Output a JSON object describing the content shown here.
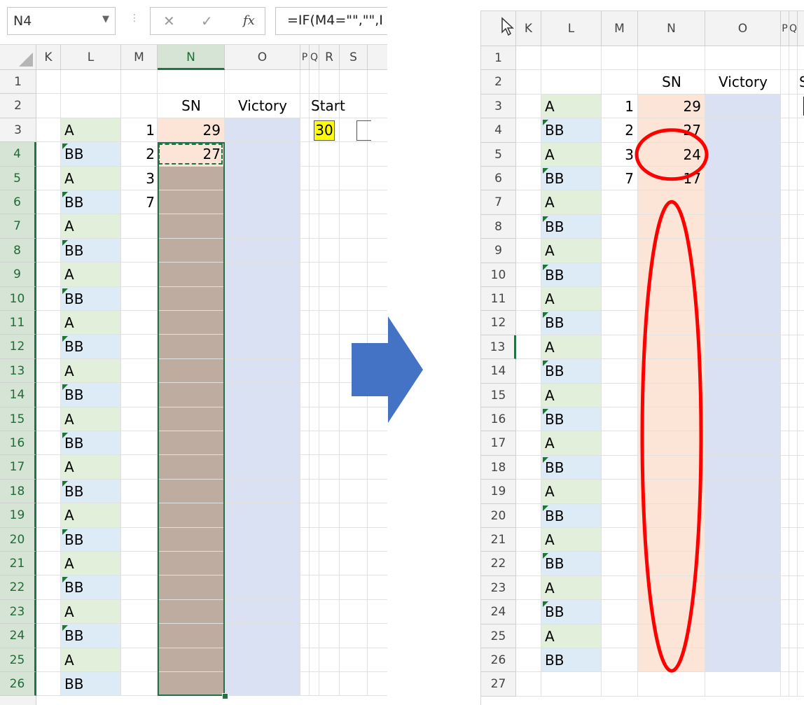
{
  "left_panel": {
    "name_box": "N4",
    "formula_text": "=IF(M4=\"\",\"\",I",
    "formula_buttons": {
      "cancel": "✕",
      "enter": "✓",
      "fx": "fx"
    },
    "col_headers": [
      "K",
      "L",
      "M",
      "N",
      "O",
      "P",
      "Q",
      "R",
      "S"
    ],
    "rows": [
      "1",
      "2",
      "3",
      "4",
      "5",
      "6",
      "7",
      "8",
      "9",
      "10",
      "11",
      "12",
      "13",
      "14",
      "15",
      "16",
      "17",
      "18",
      "19",
      "20",
      "21",
      "22",
      "23",
      "24",
      "25",
      "26"
    ],
    "headers_row2": {
      "sn": "SN",
      "victory": "Victory",
      "start": "Start"
    },
    "start_value": "30",
    "l_values": [
      "A",
      "BB",
      "A",
      "BB",
      "A",
      "BB",
      "A",
      "BB",
      "A",
      "BB",
      "A",
      "BB",
      "A",
      "BB",
      "A",
      "BB",
      "A",
      "BB",
      "A",
      "BB",
      "A",
      "BB",
      "A",
      "BB"
    ],
    "m_values": [
      "1",
      "2",
      "3",
      "7"
    ],
    "n_values": [
      "29",
      "27"
    ]
  },
  "right_panel": {
    "col_headers": [
      "K",
      "L",
      "M",
      "N",
      "O",
      "P",
      "Q"
    ],
    "rows": [
      "1",
      "2",
      "3",
      "4",
      "5",
      "6",
      "7",
      "8",
      "9",
      "10",
      "11",
      "12",
      "13",
      "14",
      "15",
      "16",
      "17",
      "18",
      "19",
      "20",
      "21",
      "22",
      "23",
      "24",
      "25",
      "26",
      "27"
    ],
    "headers_row2": {
      "sn": "SN",
      "victory": "Victory",
      "extra": "S"
    },
    "l_values": [
      "A",
      "BB",
      "A",
      "BB",
      "A",
      "BB",
      "A",
      "BB",
      "A",
      "BB",
      "A",
      "BB",
      "A",
      "BB",
      "A",
      "BB",
      "A",
      "BB",
      "A",
      "BB",
      "A",
      "BB",
      "A",
      "BB"
    ],
    "m_values": [
      "1",
      "2",
      "3",
      "7"
    ],
    "n_values": [
      "29",
      "27",
      "24",
      "17"
    ]
  },
  "colors": {
    "green_fill": "#e2efda",
    "blue_fill": "#ddebf7",
    "salmon": "#fce4d6",
    "victory": "#d9e1f2",
    "brown": "#bfaca0",
    "start_yellow": "#ffff00",
    "arrow": "#4472c4",
    "circle": "#ff0000",
    "excel_green": "#217346"
  }
}
